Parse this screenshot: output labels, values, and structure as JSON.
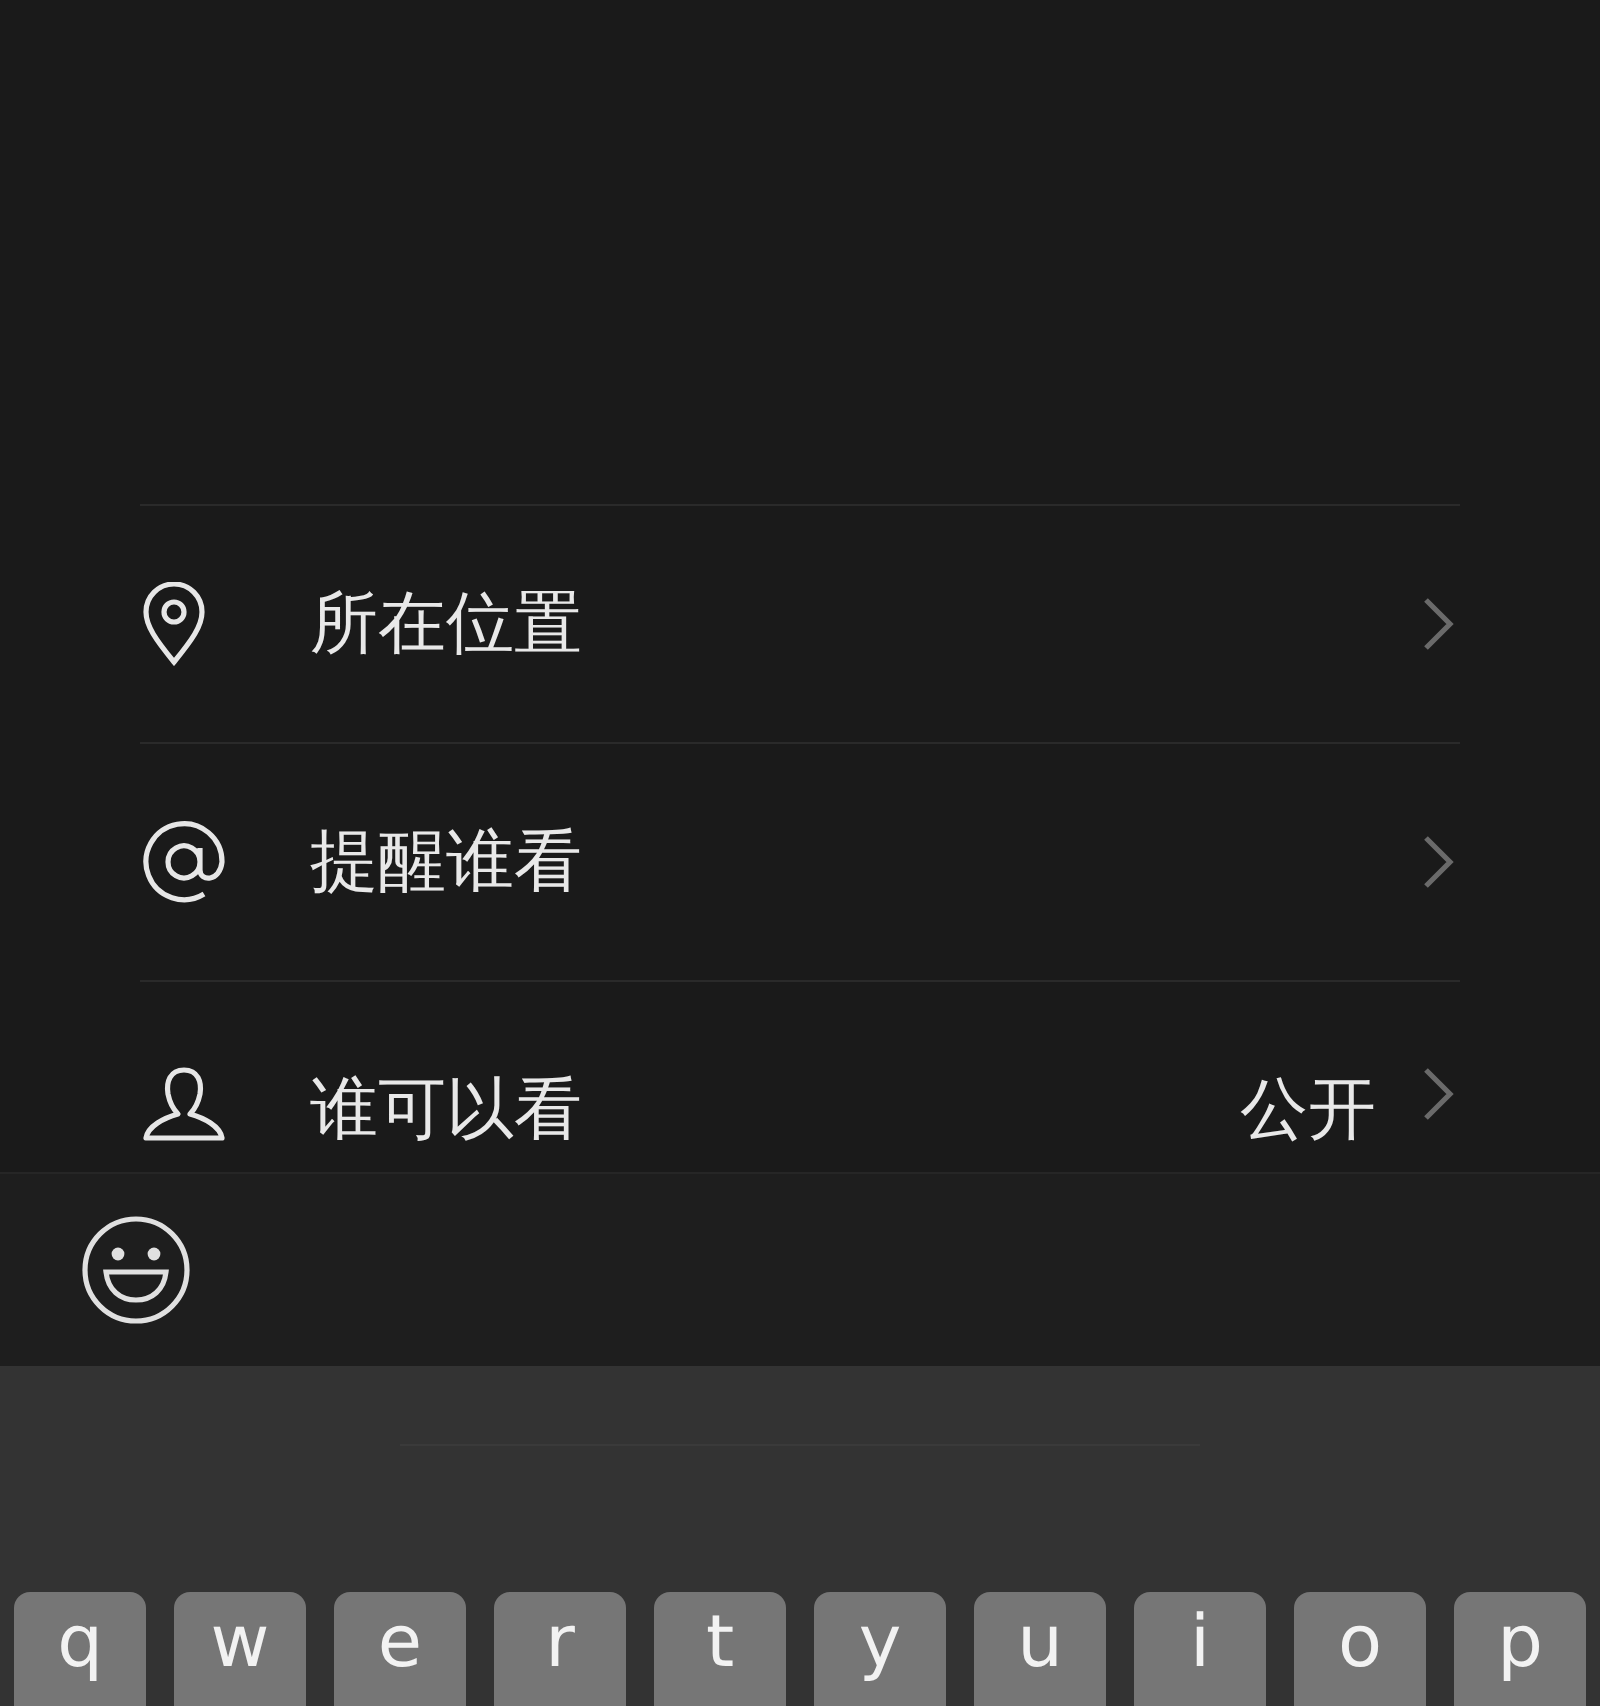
{
  "options": [
    {
      "kind": "location",
      "label": "所在位置"
    },
    {
      "kind": "mention",
      "label": "提醒谁看"
    },
    {
      "kind": "audience",
      "label": "谁可以看",
      "value": "公开"
    }
  ],
  "keyboard": {
    "keys": [
      "q",
      "w",
      "e",
      "r",
      "t",
      "y",
      "u",
      "i",
      "o",
      "p"
    ]
  }
}
